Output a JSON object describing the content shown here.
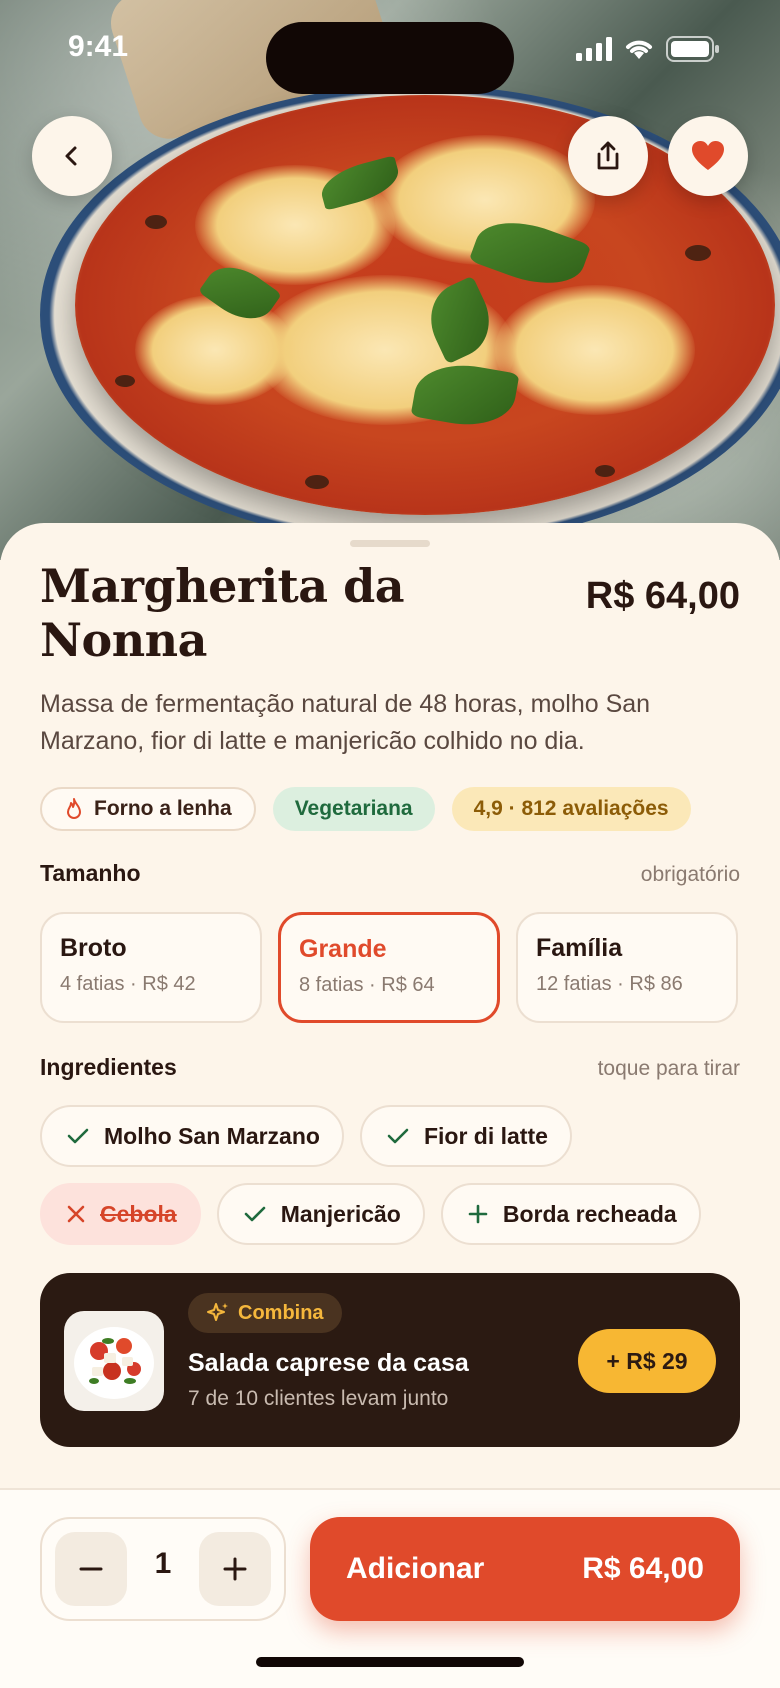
{
  "status_bar": {
    "time": "9:41"
  },
  "hero": {
    "icons": {
      "back": "chevron-left-icon",
      "share": "share-icon",
      "favorite": "heart-icon"
    }
  },
  "product": {
    "name": "Margherita da Nonna",
    "price": "R$ 64,00",
    "description": "Massa de fermentação natural de 48 horas, molho San Marzano, fior di latte e manjericão colhido no dia."
  },
  "tags": [
    {
      "label": "Forno a lenha",
      "icon": "flame-icon"
    },
    {
      "label": "Vegetariana"
    },
    {
      "label": "4,9 · 812 avaliações"
    }
  ],
  "size_section": {
    "title": "Tamanho",
    "hint": "obrigatório",
    "options": [
      {
        "name": "Broto",
        "detail": "4 fatias · R$ 42"
      },
      {
        "name": "Grande",
        "detail": "8 fatias · R$ 64"
      },
      {
        "name": "Família",
        "detail": "12 fatias · R$ 86"
      }
    ],
    "selected": "Grande"
  },
  "ingredients_section": {
    "title": "Ingredientes",
    "hint": "toque para tirar",
    "items": [
      {
        "label": "Molho San Marzano",
        "state": "included"
      },
      {
        "label": "Fior di latte",
        "state": "included"
      },
      {
        "label": "Cebola",
        "state": "removed"
      },
      {
        "label": "Manjericão",
        "state": "included"
      },
      {
        "label": "Borda recheada",
        "state": "addable"
      }
    ]
  },
  "combo": {
    "badge": "Combina",
    "name": "Salada caprese da casa",
    "subtitle": "7 de 10 clientes levam junto",
    "add_label": "+ R$ 29"
  },
  "cart": {
    "quantity": "1",
    "add_label": "Adicionar",
    "total": "R$ 64,00"
  },
  "colors": {
    "accent": "#e04a2b",
    "background": "#fdf5ea",
    "dark_card": "#2b1a12",
    "gold": "#f7b733",
    "green_tag_bg": "#dcefdf"
  }
}
